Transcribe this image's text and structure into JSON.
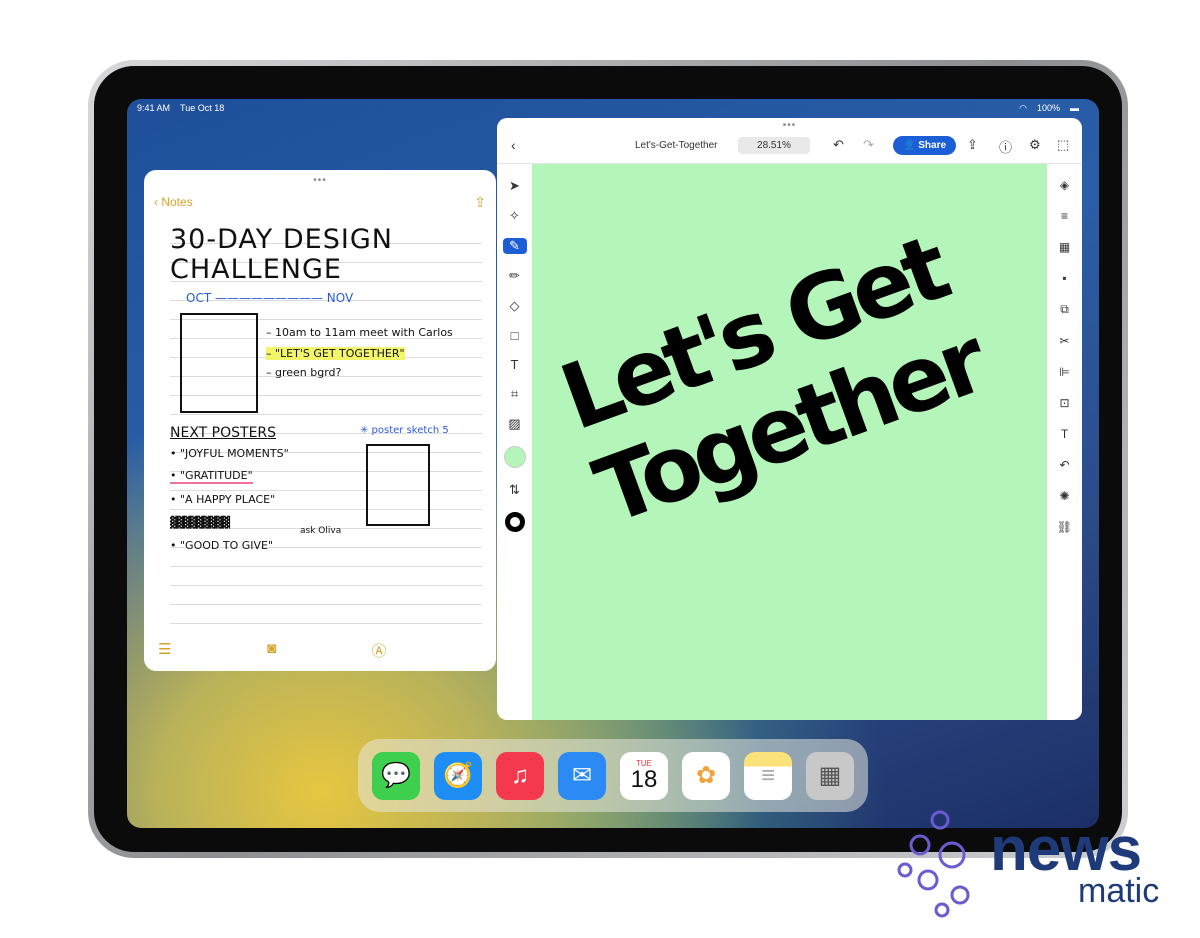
{
  "status": {
    "time": "9:41 AM",
    "date": "Tue Oct 18",
    "battery": "100%"
  },
  "notes": {
    "back": "Notes",
    "title1": "30-DAY DESIGN",
    "title2": "CHALLENGE",
    "oct": "OCT",
    "nov": "NOV",
    "lines": [
      "– 10am to 11am meet with Carlos",
      "– \"LET'S GET TOGETHER\"",
      "– green bgrd?"
    ],
    "posters_heading": "NEXT POSTERS",
    "sketch_label": "✳ poster sketch 5",
    "posters": [
      "• \"JOYFUL MOMENTS\"",
      "• \"GRATITUDE\"",
      "• \"A HAPPY PLACE\"",
      "• \"GOOD TO GIVE\""
    ],
    "ask": "ask Oliva"
  },
  "illustrator": {
    "doc_title": "Let's-Get-Together",
    "zoom": "28.51%",
    "share": "Share",
    "fill_color": "#b4f5b9"
  },
  "artwork": {
    "text": "Let's Get Together"
  },
  "dock": [
    {
      "name": "Messages",
      "icon": "💬",
      "color": "#3fcf4f"
    },
    {
      "name": "Safari",
      "icon": "🧭",
      "color": "#1e8ef5"
    },
    {
      "name": "Music",
      "icon": "♫",
      "color": "#f4394f"
    },
    {
      "name": "Mail",
      "icon": "✉",
      "color": "#2c8af5"
    },
    {
      "name": "Calendar",
      "day": "TUE",
      "date": "18",
      "color": "#ffffff"
    },
    {
      "name": "Photos",
      "icon": "✿",
      "color": "#ffffff"
    },
    {
      "name": "Notes",
      "icon": "≡",
      "color": "#fbe27a"
    },
    {
      "name": "App Library",
      "icon": "▦",
      "color": "#c8c8c8"
    }
  ],
  "watermark": {
    "line1": "news",
    "line2": "matic"
  }
}
